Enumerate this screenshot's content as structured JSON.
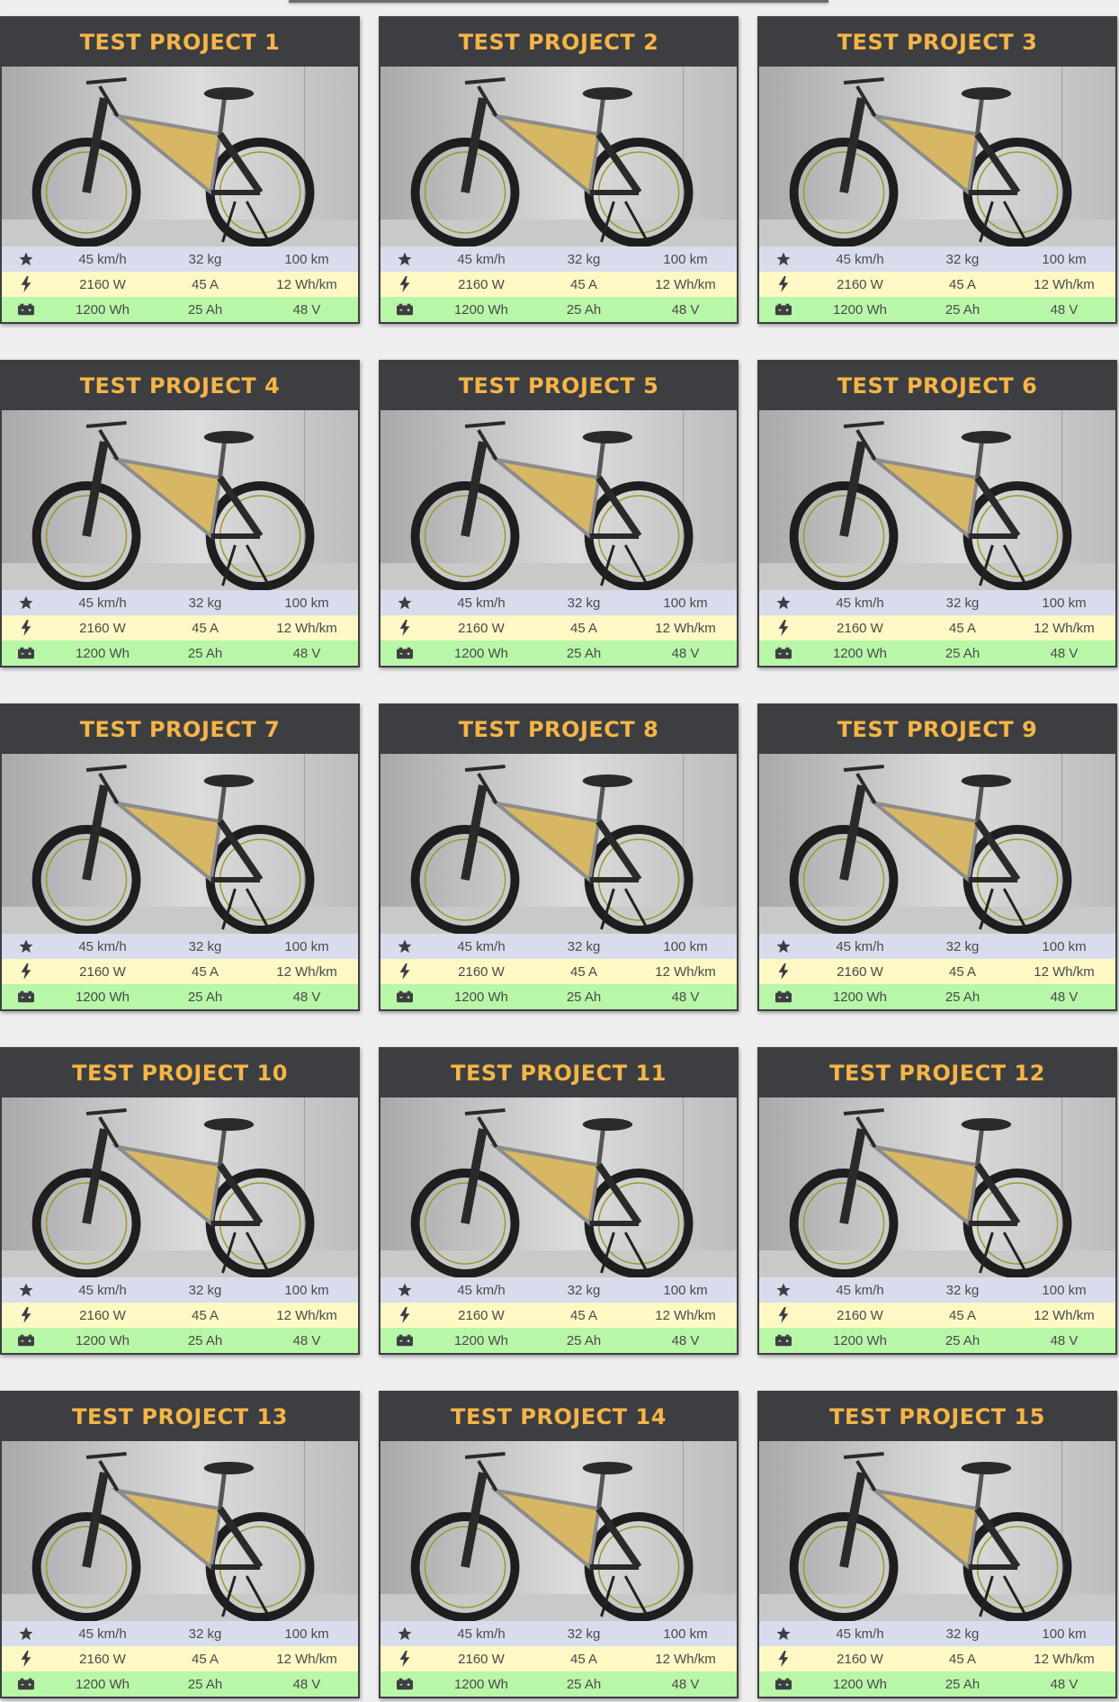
{
  "projects": [
    {
      "title": "TEST PROJECT 1"
    },
    {
      "title": "TEST PROJECT 2"
    },
    {
      "title": "TEST PROJECT 3"
    },
    {
      "title": "TEST PROJECT 4"
    },
    {
      "title": "TEST PROJECT 5"
    },
    {
      "title": "TEST PROJECT 6"
    },
    {
      "title": "TEST PROJECT 7"
    },
    {
      "title": "TEST PROJECT 8"
    },
    {
      "title": "TEST PROJECT 9"
    },
    {
      "title": "TEST PROJECT 10"
    },
    {
      "title": "TEST PROJECT 11"
    },
    {
      "title": "TEST PROJECT 12"
    },
    {
      "title": "TEST PROJECT 13"
    },
    {
      "title": "TEST PROJECT 14"
    },
    {
      "title": "TEST PROJECT 15"
    }
  ],
  "stats": {
    "performance": {
      "icon": "star-icon",
      "speed": "45 km/h",
      "weight": "32 kg",
      "range": "100 km"
    },
    "power": {
      "icon": "lightning-bolt-icon",
      "power": "2160 W",
      "current": "45 A",
      "consumption": "12 Wh/km"
    },
    "battery": {
      "icon": "battery-icon",
      "energy": "1200 Wh",
      "capacity": "25 Ah",
      "voltage": "48 V"
    }
  },
  "colors": {
    "header_bg": "#3d3e42",
    "title_text": "#f5b547",
    "row_performance": "#d9dcec",
    "row_power": "#fdf8c4",
    "row_battery": "#b9f7a8"
  }
}
